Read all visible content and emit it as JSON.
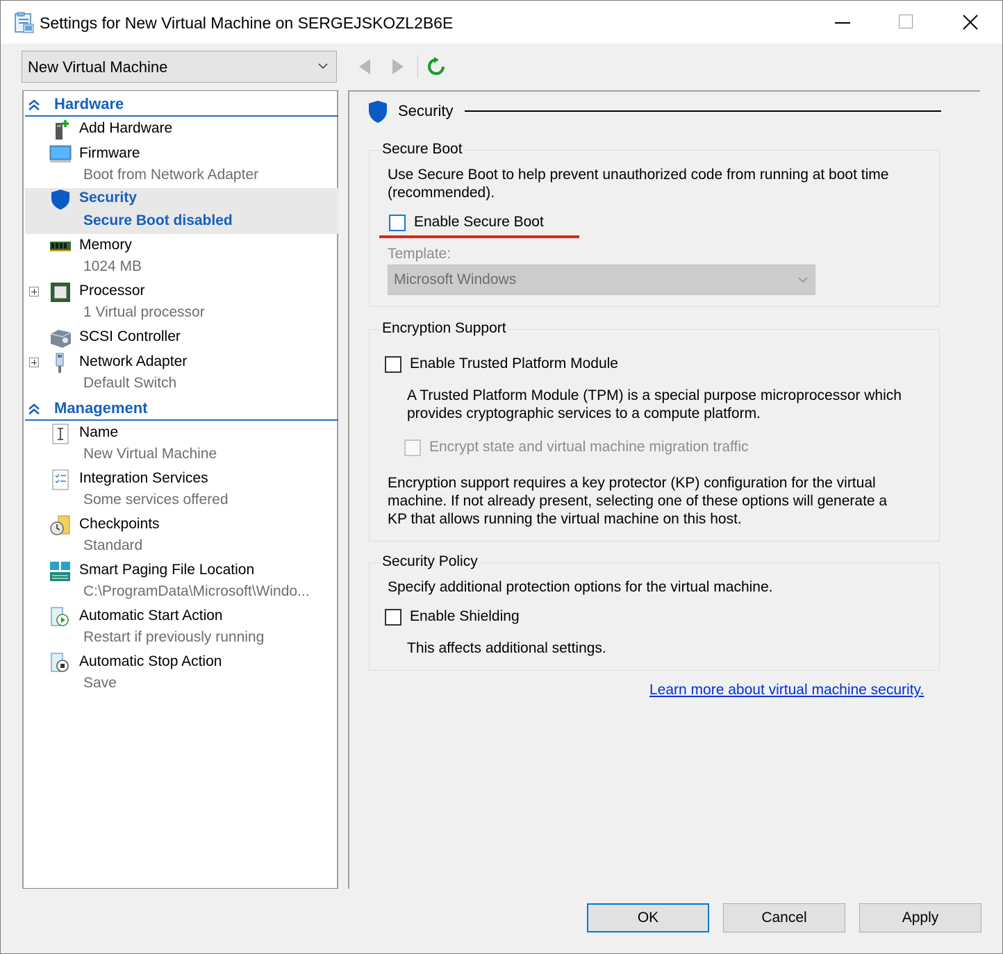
{
  "window": {
    "title": "Settings for New Virtual Machine on SERGEJSKOZL2B6E"
  },
  "toolbar": {
    "vm_selected": "New Virtual Machine"
  },
  "tree": {
    "hardware_label": "Hardware",
    "management_label": "Management",
    "hardware_items": [
      {
        "label": "Add Hardware",
        "sub": ""
      },
      {
        "label": "Firmware",
        "sub": "Boot from Network Adapter"
      },
      {
        "label": "Security",
        "sub": "Secure Boot disabled"
      },
      {
        "label": "Memory",
        "sub": "1024 MB"
      },
      {
        "label": "Processor",
        "sub": "1 Virtual processor"
      },
      {
        "label": "SCSI Controller",
        "sub": ""
      },
      {
        "label": "Network Adapter",
        "sub": "Default Switch"
      }
    ],
    "management_items": [
      {
        "label": "Name",
        "sub": "New Virtual Machine"
      },
      {
        "label": "Integration Services",
        "sub": "Some services offered"
      },
      {
        "label": "Checkpoints",
        "sub": "Standard"
      },
      {
        "label": "Smart Paging File Location",
        "sub": "C:\\ProgramData\\Microsoft\\Windo..."
      },
      {
        "label": "Automatic Start Action",
        "sub": "Restart if previously running"
      },
      {
        "label": "Automatic Stop Action",
        "sub": "Save"
      }
    ]
  },
  "panel": {
    "heading": "Security",
    "secure_boot": {
      "title": "Secure Boot",
      "desc_line1": "Use Secure Boot to help prevent unauthorized code from running at boot time",
      "desc_line2": "(recommended).",
      "checkbox_label": "Enable Secure Boot",
      "checked": false,
      "template_label": "Template:",
      "template_value": "Microsoft Windows"
    },
    "encryption": {
      "title": "Encryption Support",
      "tpm_label": "Enable Trusted Platform Module",
      "tpm_desc_line1": "A Trusted Platform Module (TPM) is a special purpose microprocessor which",
      "tpm_desc_line2": "provides cryptographic services to a compute platform.",
      "encrypt_label": "Encrypt state and virtual machine migration traffic",
      "kp_line1": "Encryption support requires a key protector (KP) configuration for the virtual",
      "kp_line2": "machine. If not already present, selecting one of these options will generate a",
      "kp_line3": "KP that allows running the virtual machine on this host."
    },
    "policy": {
      "title": "Security Policy",
      "desc": "Specify additional protection options for the virtual machine.",
      "shielding_label": "Enable Shielding",
      "note": "This affects additional settings."
    },
    "learn_more": "Learn more about virtual machine security."
  },
  "buttons": {
    "ok": "OK",
    "cancel": "Cancel",
    "apply": "Apply"
  },
  "colors": {
    "accent_blue": "#1560bd",
    "highlight_red": "#e8201a",
    "link": "#0030d8"
  }
}
